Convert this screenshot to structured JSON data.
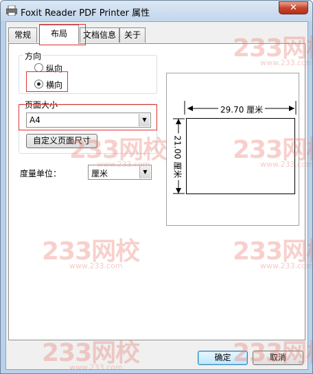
{
  "window": {
    "title": "Foxit Reader PDF Printer 属性",
    "close_label": "✕"
  },
  "tabs": [
    {
      "label": "常规",
      "active": false
    },
    {
      "label": "布局",
      "active": true
    },
    {
      "label": "文档信息",
      "active": false
    },
    {
      "label": "关于",
      "active": false
    }
  ],
  "orientation": {
    "group_label": "方向",
    "options": [
      {
        "label": "纵向",
        "selected": false
      },
      {
        "label": "横向",
        "selected": true
      }
    ]
  },
  "page_size": {
    "group_label": "页面大小",
    "value": "A4",
    "custom_button": "自定义页面尺寸"
  },
  "units": {
    "label": "度量单位：",
    "value": "厘米"
  },
  "preview": {
    "width_label": "29.70 厘米",
    "height_label": "21.00 厘米"
  },
  "footer": {
    "ok_label": "确定",
    "cancel_label": "取消"
  },
  "watermark": {
    "text": "233网校",
    "url": "www.233.com"
  },
  "colors": {
    "highlight": "#e0302a",
    "watermark": "#e9786e"
  }
}
